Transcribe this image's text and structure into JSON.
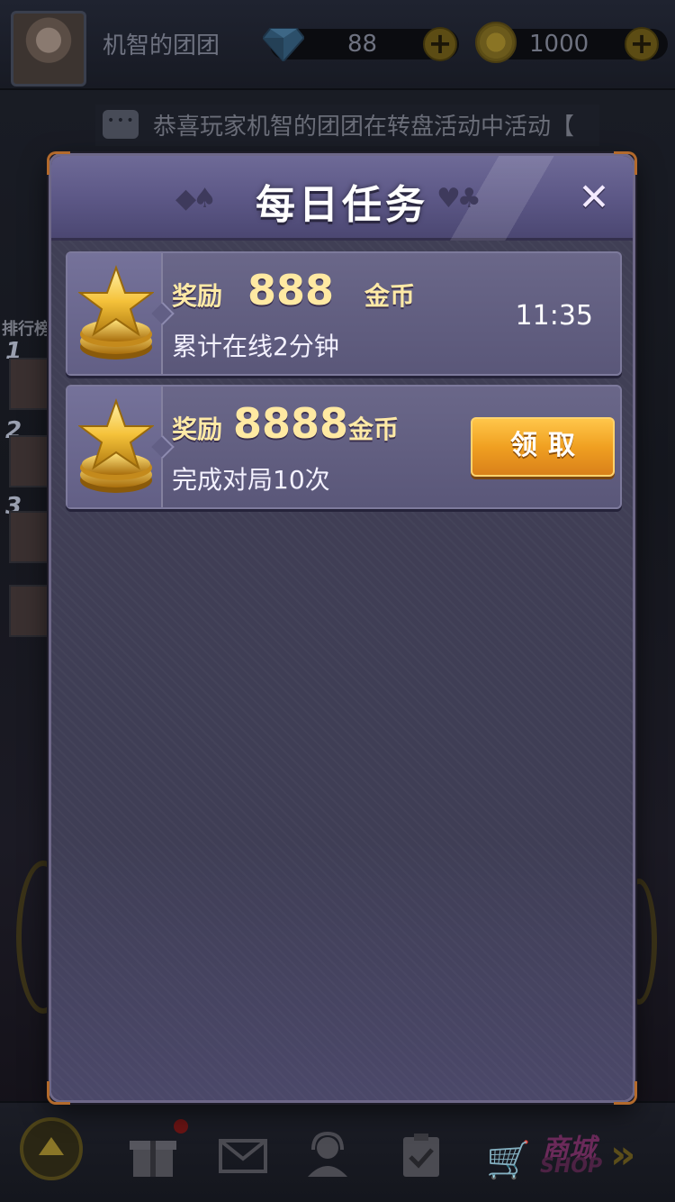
{
  "player": {
    "nickname": "机智的团团",
    "diamonds": "88",
    "gold": "1000"
  },
  "notice": {
    "text": "恭喜玩家机智的团团在转盘活动中活动【"
  },
  "leaderboard": {
    "title": "排行榜",
    "ranks": [
      "1",
      "2",
      "3"
    ]
  },
  "dialog": {
    "title": "每日任务",
    "tasks": [
      {
        "reward_label": "奖励",
        "reward_amount": "888",
        "reward_unit": "金币",
        "description": "累计在线2分钟",
        "timer": "11:35"
      },
      {
        "reward_label": "奖励",
        "reward_amount": "8888",
        "reward_unit": "金币",
        "description": "完成对局10次",
        "claim_label": "领取"
      }
    ]
  },
  "shop": {
    "label_cn": "商城",
    "label_en": "SHOP"
  },
  "icons": {
    "diamond": "diamond-icon",
    "coin": "coin-icon",
    "close": "close-icon",
    "task_reward": "gold-star-coins-icon",
    "home": "home-up-icon",
    "gift": "gift-icon",
    "mail": "mail-icon",
    "service": "customer-service-icon",
    "tasks": "clipboard-icon",
    "cart": "shop-cart-icon"
  },
  "colors": {
    "gold_text": "#ffe9a2",
    "claim_button": "#f0a021",
    "dialog_header": "#5d5887",
    "dialog_body": "#403f55"
  }
}
